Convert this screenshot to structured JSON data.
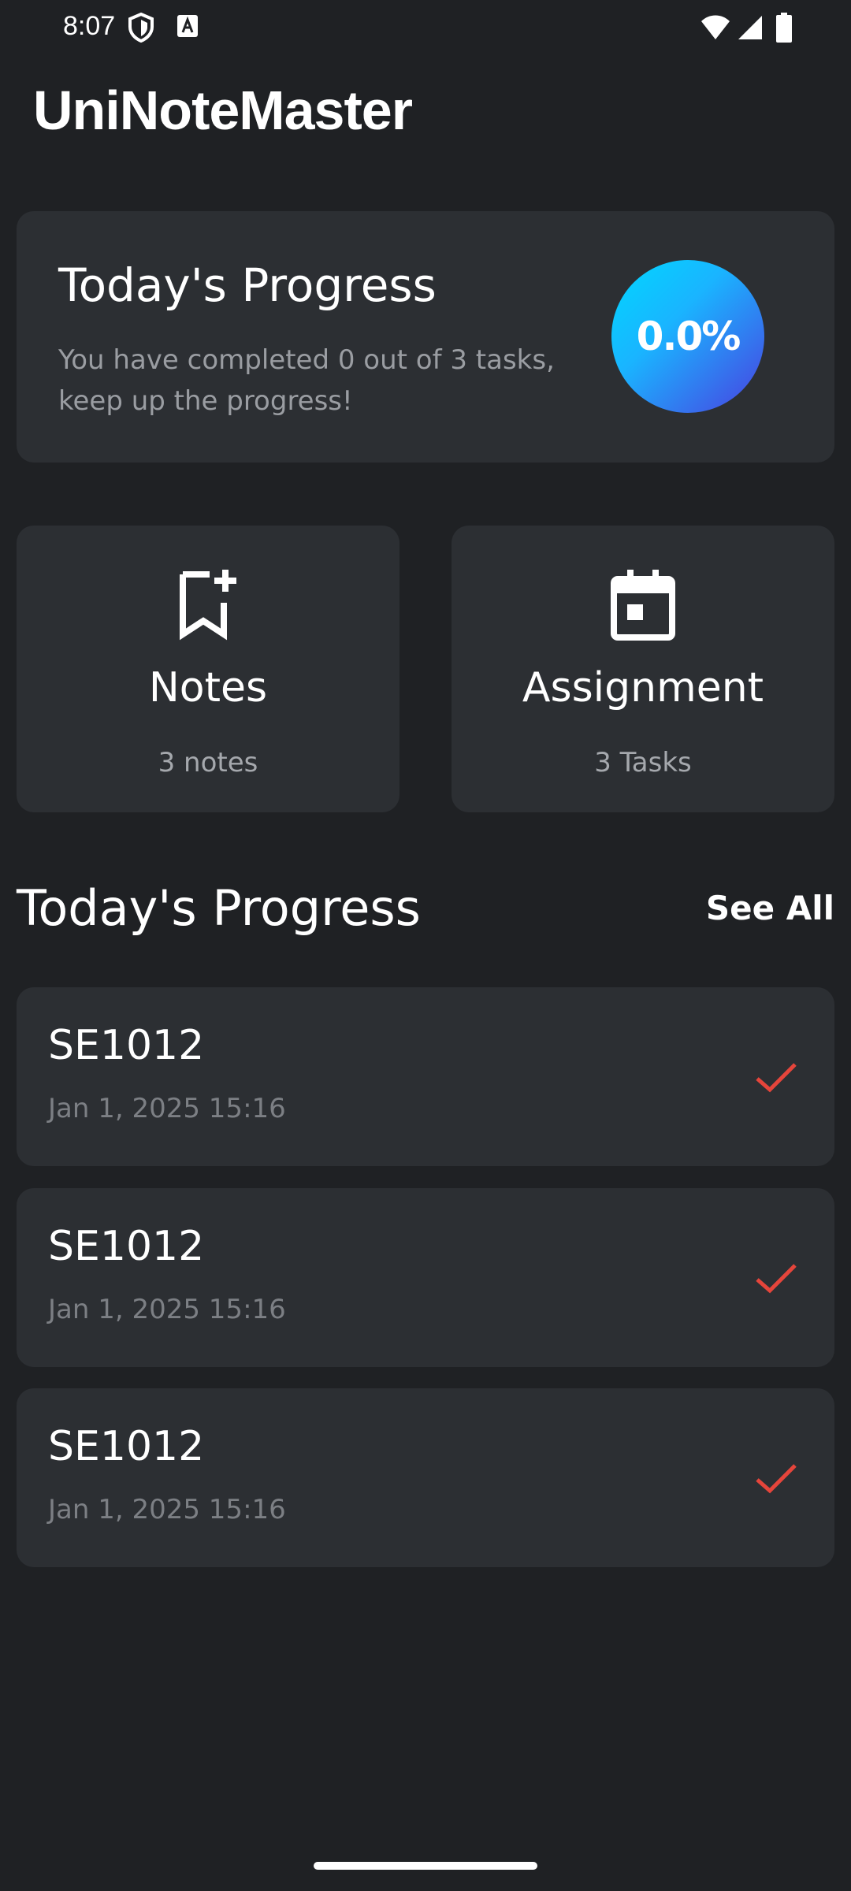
{
  "status_bar": {
    "time": "8:07",
    "icons_left": [
      "shield-icon",
      "font-a-icon"
    ],
    "icons_right": [
      "wifi-icon",
      "signal-icon",
      "battery-icon"
    ]
  },
  "app": {
    "title": "UniNoteMaster"
  },
  "progress_card": {
    "title": "Today's Progress",
    "description": "You have completed 0 out of 3 tasks, keep up the progress!",
    "percent_label": "0.0%",
    "gradient_colors": [
      "#00d8ff",
      "#4a3fe0"
    ]
  },
  "tiles": [
    {
      "label": "Notes",
      "sub": "3 notes",
      "icon": "bookmark-add-icon"
    },
    {
      "label": "Assignment",
      "sub": "3 Tasks",
      "icon": "calendar-icon"
    }
  ],
  "section": {
    "title": "Today's Progress",
    "see_all": "See All"
  },
  "tasks": [
    {
      "title": "SE1012",
      "date": "Jan 1, 2025 15:16",
      "icon": "check-icon"
    },
    {
      "title": "SE1012",
      "date": "Jan 1, 2025 15:16",
      "icon": "check-icon"
    },
    {
      "title": "SE1012",
      "date": "Jan 1, 2025 15:16",
      "icon": "check-icon"
    }
  ],
  "colors": {
    "background": "#1f2124",
    "card": "#2c2f33",
    "check": "#e5453b"
  }
}
